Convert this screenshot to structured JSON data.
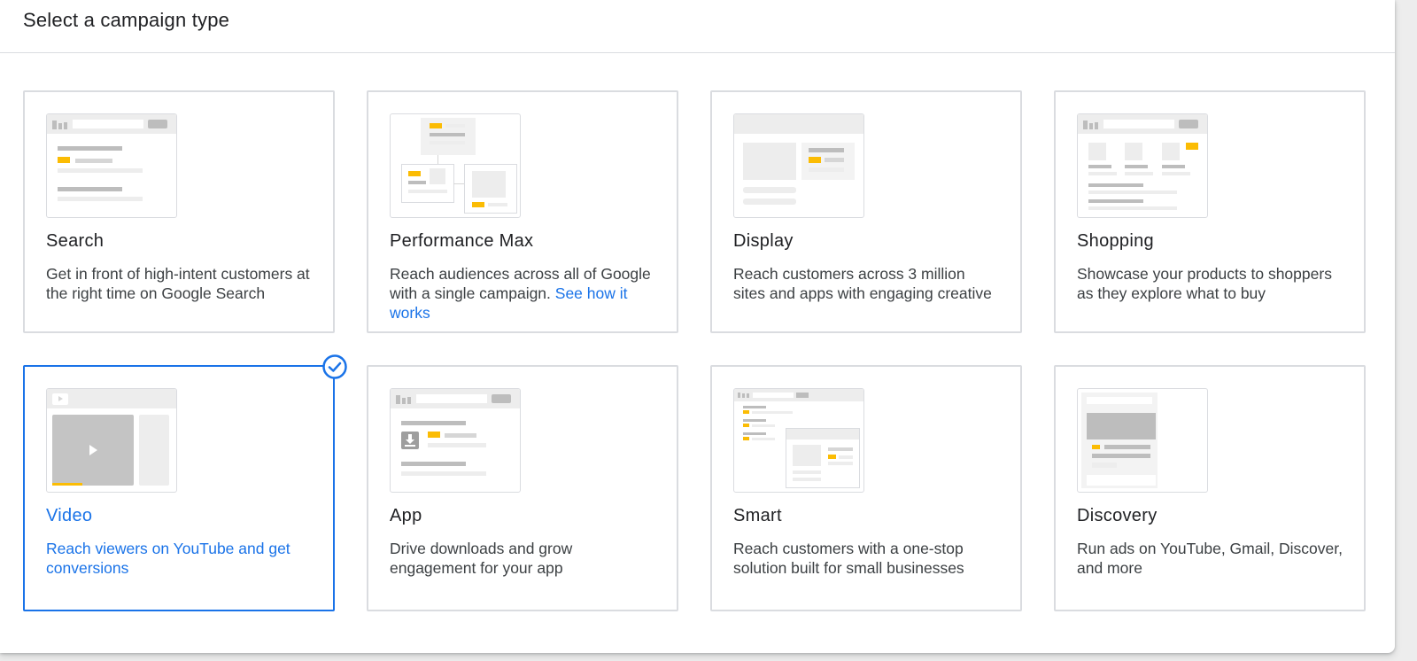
{
  "header": {
    "title": "Select a campaign type"
  },
  "colors": {
    "accent": "#1a73e8",
    "highlight": "#fbbc04",
    "border": "#dadce0"
  },
  "campaigns": [
    {
      "title": "Search",
      "description": "Get in front of high-intent customers at the right time on Google Search",
      "icon": "search-illustration-icon"
    },
    {
      "title": "Performance Max",
      "description": "Reach audiences across all of Google with a single campaign.",
      "link": "See how it works",
      "icon": "performance-max-illustration-icon"
    },
    {
      "title": "Display",
      "description": "Reach customers across 3 million sites and apps with engaging creative",
      "icon": "display-illustration-icon"
    },
    {
      "title": "Shopping",
      "description": "Showcase your products to shoppers as they explore what to buy",
      "icon": "shopping-illustration-icon"
    },
    {
      "title": "Video",
      "description": "Reach viewers on YouTube and get conversions",
      "selected": true,
      "icon": "video-illustration-icon"
    },
    {
      "title": "App",
      "description": "Drive downloads and grow engagement for your app",
      "icon": "app-illustration-icon"
    },
    {
      "title": "Smart",
      "description": "Reach customers with a one-stop solution built for small businesses",
      "icon": "smart-illustration-icon"
    },
    {
      "title": "Discovery",
      "description": "Run ads on YouTube, Gmail, Discover, and more",
      "icon": "discovery-illustration-icon"
    }
  ]
}
